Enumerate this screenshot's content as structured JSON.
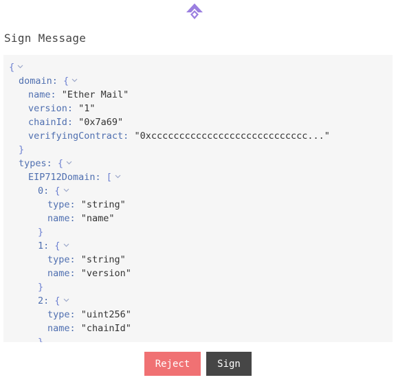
{
  "header": {
    "title": "Sign Message",
    "logo_icon": "logo-icon",
    "brand_color": "#9b7fe0"
  },
  "json_lines": [
    {
      "indent": 0,
      "parts": [
        {
          "t": "{",
          "c": "brace"
        }
      ],
      "chevron": true
    },
    {
      "indent": 1,
      "parts": [
        {
          "t": "domain: ",
          "c": "key"
        },
        {
          "t": "{",
          "c": "brace"
        }
      ],
      "chevron": true
    },
    {
      "indent": 2,
      "parts": [
        {
          "t": "name: ",
          "c": "key"
        },
        {
          "t": "\"Ether Mail\"",
          "c": "str"
        }
      ],
      "chevron": false
    },
    {
      "indent": 2,
      "parts": [
        {
          "t": "version: ",
          "c": "key"
        },
        {
          "t": "\"1\"",
          "c": "str"
        }
      ],
      "chevron": false
    },
    {
      "indent": 2,
      "parts": [
        {
          "t": "chainId: ",
          "c": "key"
        },
        {
          "t": "\"0x7a69\"",
          "c": "str"
        }
      ],
      "chevron": false
    },
    {
      "indent": 2,
      "parts": [
        {
          "t": "verifyingContract: ",
          "c": "key"
        },
        {
          "t": "\"0xcccccccccccccccccccccccccccc...\"",
          "c": "str"
        }
      ],
      "chevron": false
    },
    {
      "indent": 1,
      "parts": [
        {
          "t": "}",
          "c": "brace"
        }
      ],
      "chevron": false
    },
    {
      "indent": 1,
      "parts": [
        {
          "t": "types: ",
          "c": "key"
        },
        {
          "t": "{",
          "c": "brace"
        }
      ],
      "chevron": true
    },
    {
      "indent": 2,
      "parts": [
        {
          "t": "EIP712Domain: ",
          "c": "key"
        },
        {
          "t": "[",
          "c": "brace"
        }
      ],
      "chevron": true
    },
    {
      "indent": 3,
      "parts": [
        {
          "t": "0: ",
          "c": "key"
        },
        {
          "t": "{",
          "c": "brace"
        }
      ],
      "chevron": true
    },
    {
      "indent": 4,
      "parts": [
        {
          "t": "type: ",
          "c": "key"
        },
        {
          "t": "\"string\"",
          "c": "str"
        }
      ],
      "chevron": false
    },
    {
      "indent": 4,
      "parts": [
        {
          "t": "name: ",
          "c": "key"
        },
        {
          "t": "\"name\"",
          "c": "str"
        }
      ],
      "chevron": false
    },
    {
      "indent": 3,
      "parts": [
        {
          "t": "}",
          "c": "brace"
        }
      ],
      "chevron": false
    },
    {
      "indent": 3,
      "parts": [
        {
          "t": "1: ",
          "c": "key"
        },
        {
          "t": "{",
          "c": "brace"
        }
      ],
      "chevron": true
    },
    {
      "indent": 4,
      "parts": [
        {
          "t": "type: ",
          "c": "key"
        },
        {
          "t": "\"string\"",
          "c": "str"
        }
      ],
      "chevron": false
    },
    {
      "indent": 4,
      "parts": [
        {
          "t": "name: ",
          "c": "key"
        },
        {
          "t": "\"version\"",
          "c": "str"
        }
      ],
      "chevron": false
    },
    {
      "indent": 3,
      "parts": [
        {
          "t": "}",
          "c": "brace"
        }
      ],
      "chevron": false
    },
    {
      "indent": 3,
      "parts": [
        {
          "t": "2: ",
          "c": "key"
        },
        {
          "t": "{",
          "c": "brace"
        }
      ],
      "chevron": true
    },
    {
      "indent": 4,
      "parts": [
        {
          "t": "type: ",
          "c": "key"
        },
        {
          "t": "\"uint256\"",
          "c": "str"
        }
      ],
      "chevron": false
    },
    {
      "indent": 4,
      "parts": [
        {
          "t": "name: ",
          "c": "key"
        },
        {
          "t": "\"chainId\"",
          "c": "str"
        }
      ],
      "chevron": false
    },
    {
      "indent": 3,
      "parts": [
        {
          "t": "}",
          "c": "brace"
        }
      ],
      "chevron": false
    }
  ],
  "actions": {
    "reject_label": "Reject",
    "sign_label": "Sign",
    "reject_color": "#f07173",
    "sign_color": "#464646"
  }
}
